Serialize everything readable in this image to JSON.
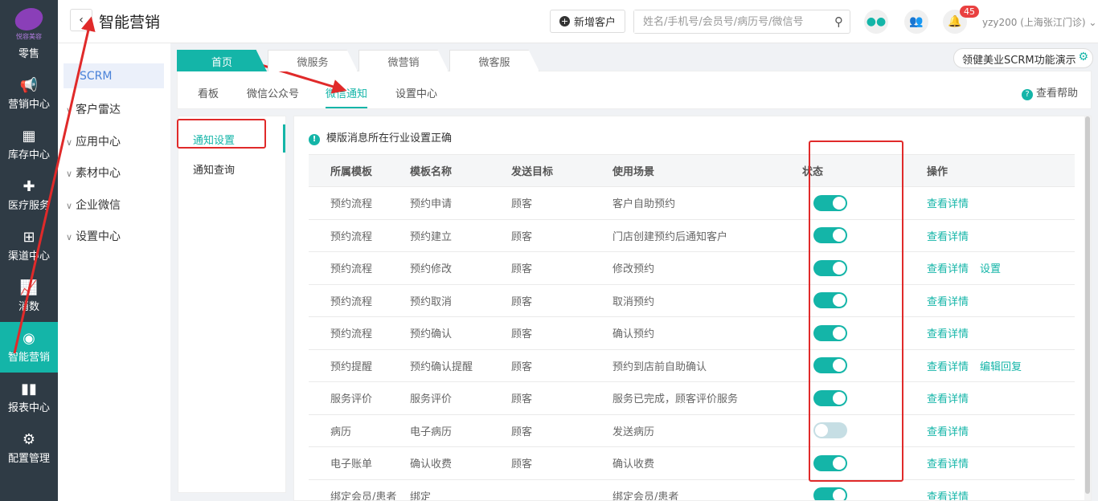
{
  "sidebar": {
    "brand": "悦容美容",
    "items": [
      {
        "label": "零售",
        "icon": "retail-icon"
      },
      {
        "label": "营销中心",
        "icon": "megaphone-icon"
      },
      {
        "label": "库存中心",
        "icon": "grid-icon"
      },
      {
        "label": "医疗服务",
        "icon": "medical-kit-icon"
      },
      {
        "label": "渠道中心",
        "icon": "org-chart-icon"
      },
      {
        "label": "消数",
        "icon": "line-chart-icon"
      },
      {
        "label": "智能营销",
        "icon": "smart-marketing-icon",
        "active": true
      },
      {
        "label": "报表中心",
        "icon": "bar-chart-icon"
      },
      {
        "label": "配置管理",
        "icon": "gear-icon"
      }
    ]
  },
  "header": {
    "title": "智能营销",
    "new_customer": "新增客户",
    "search_placeholder": "姓名/手机号/会员号/病历号/微信号",
    "notification_count": "45",
    "user": "yzy200 (上海张江门诊)"
  },
  "submenu": {
    "scrm": "SCRM",
    "items": [
      "客户雷达",
      "应用中心",
      "素材中心",
      "企业微信",
      "设置中心"
    ]
  },
  "top_tabs": [
    "首页",
    "微服务",
    "微营销",
    "微客服"
  ],
  "demo_button": "领健美业SCRM功能演示",
  "main_tabs": [
    "看板",
    "微信公众号",
    "微信通知",
    "设置中心"
  ],
  "help": "查看帮助",
  "left_nav": [
    "通知设置",
    "通知查询"
  ],
  "notice": "模版消息所在行业设置正确",
  "table": {
    "headers": [
      "所属模板",
      "模板名称",
      "发送目标",
      "使用场景",
      "状态",
      "操作"
    ],
    "rows": [
      {
        "group": "预约流程",
        "name": "预约申请",
        "target": "顾客",
        "scene": "客户自助预约",
        "on": true,
        "actions": [
          "查看详情"
        ]
      },
      {
        "group": "预约流程",
        "name": "预约建立",
        "target": "顾客",
        "scene": "门店创建预约后通知客户",
        "on": true,
        "actions": [
          "查看详情"
        ]
      },
      {
        "group": "预约流程",
        "name": "预约修改",
        "target": "顾客",
        "scene": "修改预约",
        "on": true,
        "actions": [
          "查看详情",
          "设置"
        ]
      },
      {
        "group": "预约流程",
        "name": "预约取消",
        "target": "顾客",
        "scene": "取消预约",
        "on": true,
        "actions": [
          "查看详情"
        ]
      },
      {
        "group": "预约流程",
        "name": "预约确认",
        "target": "顾客",
        "scene": "确认预约",
        "on": true,
        "actions": [
          "查看详情"
        ]
      },
      {
        "group": "预约提醒",
        "name": "预约确认提醒",
        "target": "顾客",
        "scene": "预约到店前自助确认",
        "on": true,
        "actions": [
          "查看详情",
          "编辑回复"
        ]
      },
      {
        "group": "服务评价",
        "name": "服务评价",
        "target": "顾客",
        "scene": "服务已完成，顾客评价服务",
        "on": true,
        "actions": [
          "查看详情"
        ]
      },
      {
        "group": "病历",
        "name": "电子病历",
        "target": "顾客",
        "scene": "发送病历",
        "on": false,
        "actions": [
          "查看详情"
        ]
      },
      {
        "group": "电子账单",
        "name": "确认收费",
        "target": "顾客",
        "scene": "确认收费",
        "on": true,
        "actions": [
          "查看详情"
        ]
      },
      {
        "group": "绑定会员/患者",
        "name": "绑定",
        "target": "",
        "scene": "绑定会员/患者",
        "on": true,
        "actions": [
          "查看详情"
        ]
      }
    ]
  },
  "colors": {
    "accent": "#14b5a8",
    "sidebar": "#2f3b45",
    "annotation": "#e02a2a"
  }
}
